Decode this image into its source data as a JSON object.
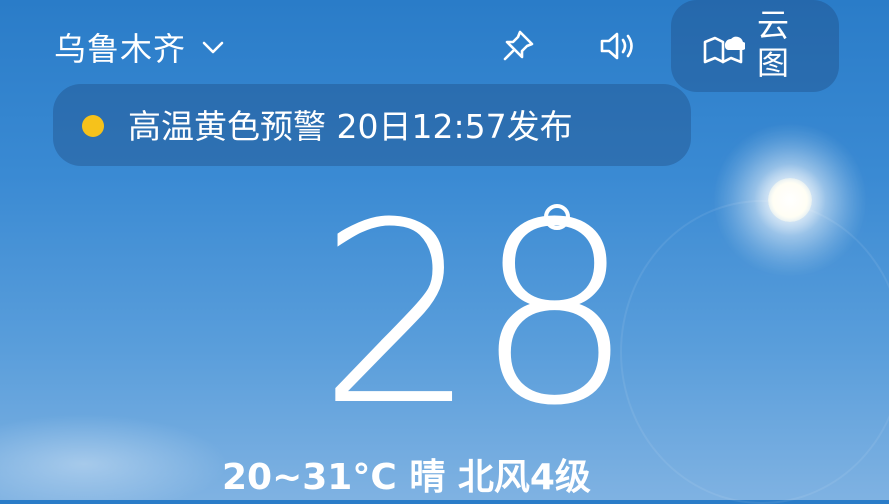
{
  "header": {
    "city": "乌鲁木齐",
    "icons": {
      "dropdown": "chevron-down-icon",
      "pin": "pin-icon",
      "sound": "speaker-icon",
      "cloud_map": "cloud-map-icon"
    },
    "cloud_map_label": "云图"
  },
  "alert": {
    "level_color": "#f6c21b",
    "text": "高温黄色预警 20日12:57发布"
  },
  "current": {
    "temperature": "28"
  },
  "summary": {
    "text": "20~31°C 晴 北风4级"
  },
  "colors": {
    "sky_top": "#2a7cc8",
    "sky_bottom": "#7fb2e2",
    "pill_bg": "rgba(30,70,120,0.35)"
  }
}
